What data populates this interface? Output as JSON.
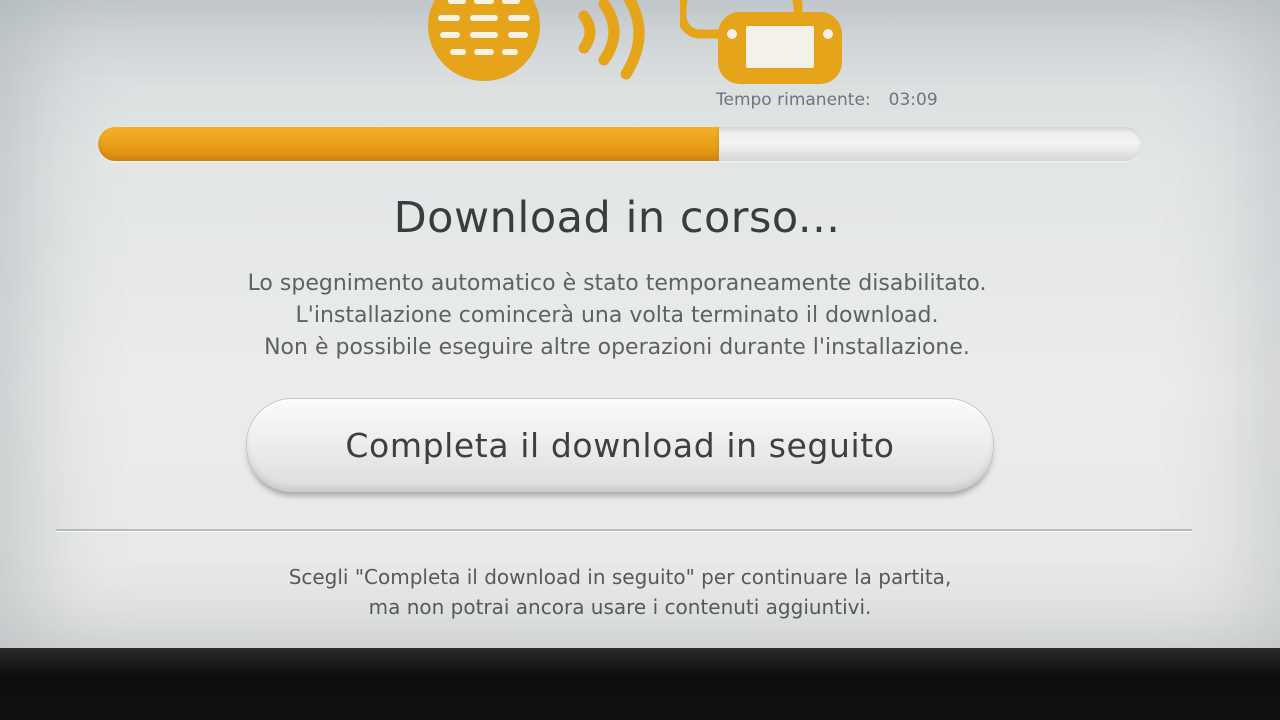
{
  "header": {
    "icons": [
      "globe-icon",
      "signal-icon",
      "gamepad-icon"
    ],
    "time_label": "Tempo rimanente:",
    "time_value": "03:09"
  },
  "progress": {
    "fraction": 0.595
  },
  "main": {
    "title": "Download in corso...",
    "messages": [
      "Lo spegnimento automatico è stato temporaneamente disabilitato.",
      "L'installazione comincerà una volta terminato il download.",
      "Non è possibile eseguire altre operazioni durante l'installazione."
    ],
    "button_label": "Completa il download in seguito"
  },
  "footer": {
    "lines": [
      "Scegli \"Completa il download in seguito\" per continuare la partita,",
      "ma non potrai ancora usare i contenuti aggiuntivi."
    ]
  },
  "colors": {
    "accent": "#eba21c",
    "icon": "#e6a41a",
    "text": "#3a3d3f"
  }
}
